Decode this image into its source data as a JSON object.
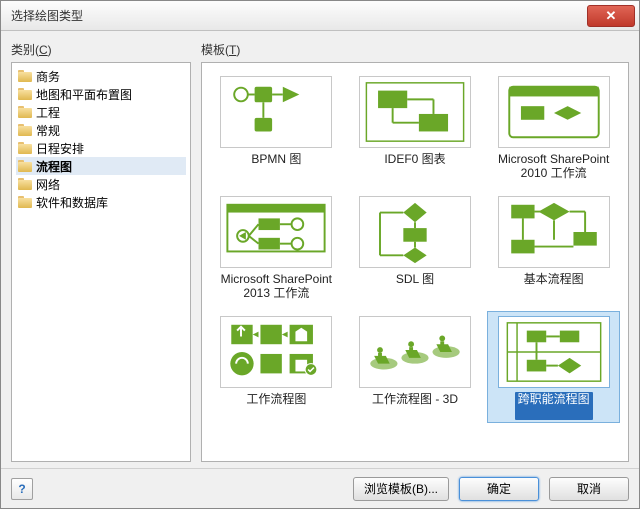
{
  "window": {
    "title": "选择绘图类型",
    "close_symbol": "✕"
  },
  "sidebar": {
    "label_pre": "类别(",
    "label_key": "C",
    "label_post": ")",
    "items": [
      {
        "label": "商务",
        "selected": false
      },
      {
        "label": "地图和平面布置图",
        "selected": false
      },
      {
        "label": "工程",
        "selected": false
      },
      {
        "label": "常规",
        "selected": false
      },
      {
        "label": "日程安排",
        "selected": false
      },
      {
        "label": "流程图",
        "selected": true
      },
      {
        "label": "网络",
        "selected": false
      },
      {
        "label": "软件和数据库",
        "selected": false
      }
    ]
  },
  "main": {
    "label_pre": "模板(",
    "label_key": "T",
    "label_post": ")",
    "templates": [
      {
        "label": "BPMN 图",
        "thumb": "bpmn",
        "selected": false
      },
      {
        "label": "IDEF0 图表",
        "thumb": "idef0",
        "selected": false
      },
      {
        "label": "Microsoft SharePoint 2010 工作流",
        "thumb": "sp2010",
        "selected": false
      },
      {
        "label": "Microsoft SharePoint 2013 工作流",
        "thumb": "sp2013",
        "selected": false
      },
      {
        "label": "SDL 图",
        "thumb": "sdl",
        "selected": false
      },
      {
        "label": "基本流程图",
        "thumb": "basic",
        "selected": false
      },
      {
        "label": "工作流程图",
        "thumb": "work",
        "selected": false
      },
      {
        "label": "工作流程图 - 3D",
        "thumb": "work3d",
        "selected": false
      },
      {
        "label": "跨职能流程图",
        "thumb": "cross",
        "selected": true
      }
    ]
  },
  "footer": {
    "help_symbol": "?",
    "browse": "浏览模板(B)...",
    "ok": "确定",
    "cancel": "取消"
  }
}
